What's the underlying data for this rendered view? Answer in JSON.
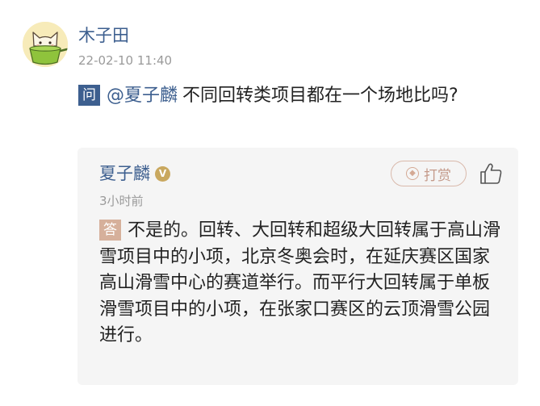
{
  "post": {
    "username": "木子田",
    "timestamp": "22-02-10 11:40",
    "question_tag": "问",
    "mention": "@夏子麟",
    "question": "不同回转类项目都在一个场地比吗?"
  },
  "answer": {
    "responder": "夏子麟",
    "verified_badge": "V",
    "reward_label": "打赏",
    "time": "3小时前",
    "answer_tag": "答",
    "text": "不是的。回转、大回转和超级大回转属于高山滑雪项目中的小项，北京冬奥会时，在延庆赛区国家高山滑雪中心的赛道举行。而平行大回转属于单板滑雪项目中的小项，在张家口赛区的云顶滑雪公园进行。"
  },
  "icons": {
    "avatar": "cartoon-cat-avatar",
    "reward": "gem-icon",
    "like": "thumbs-up-icon"
  },
  "colors": {
    "link_blue": "#3d5f8f",
    "answer_tag": "#d6b09b",
    "card_bg": "#f5f5f5",
    "muted": "#9a9a9a"
  }
}
